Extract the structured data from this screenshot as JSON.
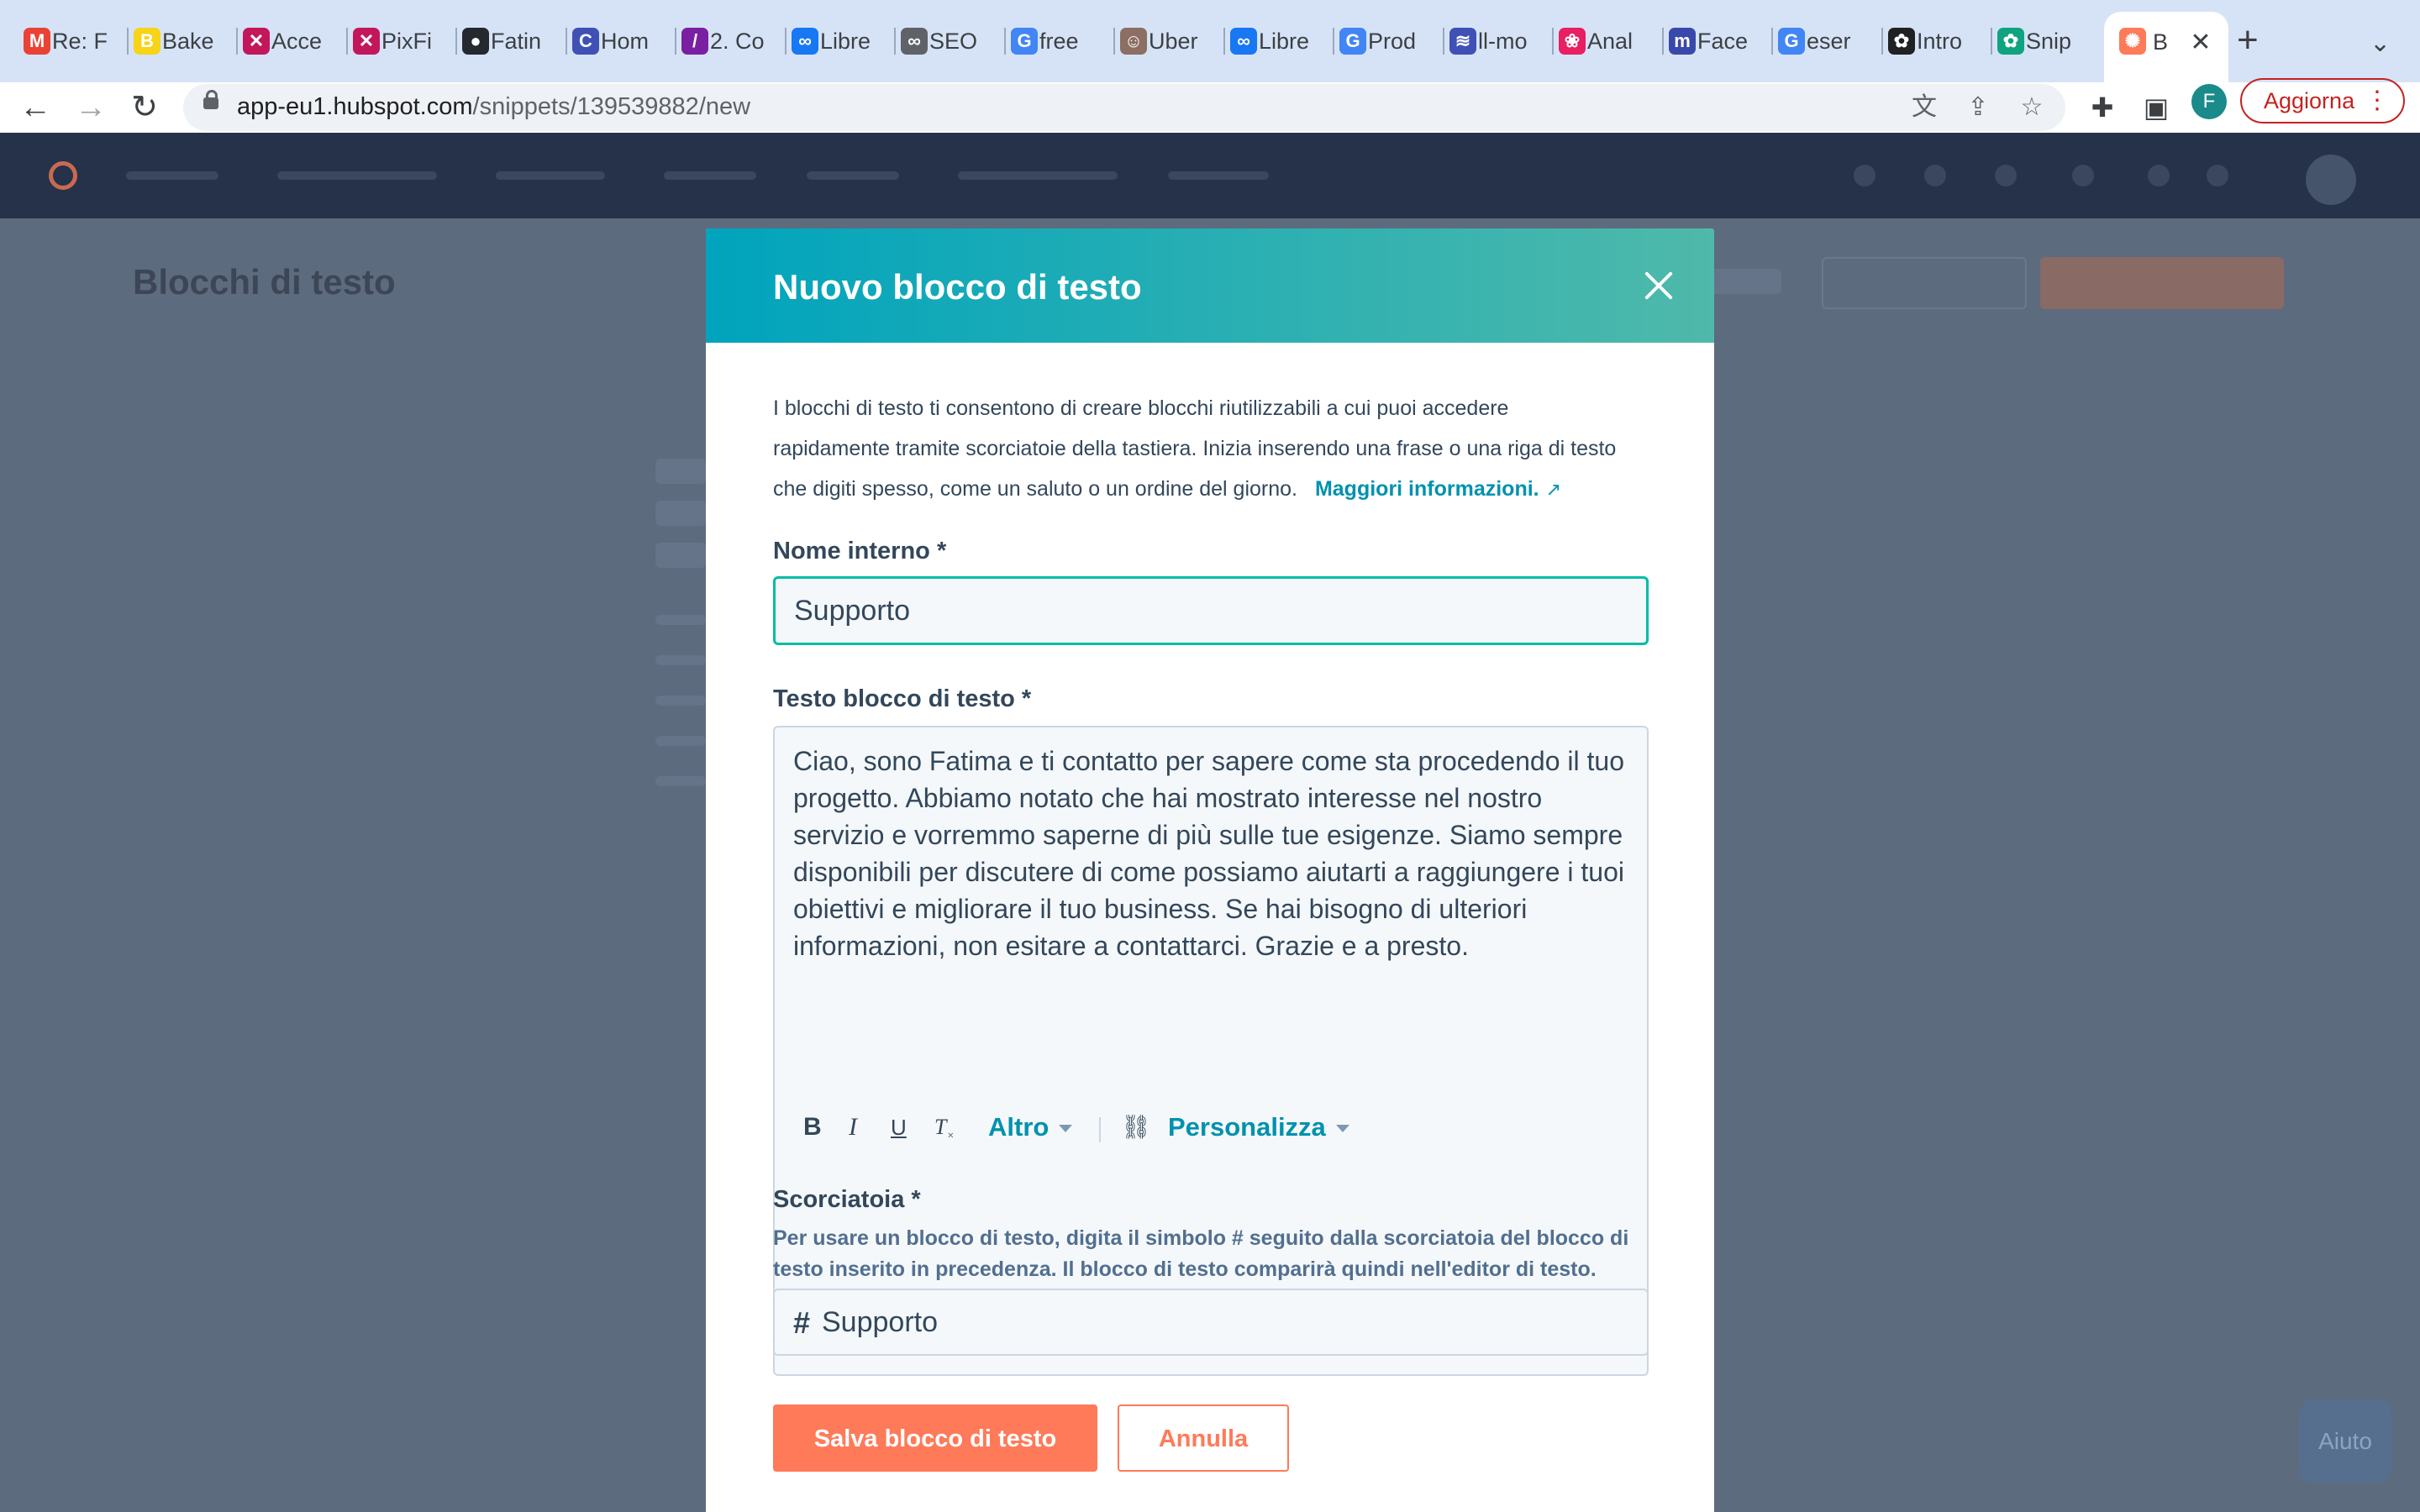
{
  "browser": {
    "tabs": [
      {
        "title": "Re: F",
        "icon": "gmail-icon",
        "color": "#ea4335",
        "glyph": "M"
      },
      {
        "title": "Bake",
        "icon": "bakery-icon",
        "color": "#f7d417",
        "glyph": "B"
      },
      {
        "title": "Acce",
        "icon": "app-icon",
        "color": "#c2185b",
        "glyph": "✕"
      },
      {
        "title": "PixFi",
        "icon": "app-icon",
        "color": "#c2185b",
        "glyph": "✕"
      },
      {
        "title": "Fatin",
        "icon": "github-icon",
        "color": "#24292f",
        "glyph": "●"
      },
      {
        "title": "Hom",
        "icon": "app-icon",
        "color": "#3f51b5",
        "glyph": "C"
      },
      {
        "title": "2. Co",
        "icon": "app-icon",
        "color": "#7b1fa2",
        "glyph": "/"
      },
      {
        "title": "Libre",
        "icon": "meta-icon",
        "color": "#1877f2",
        "glyph": "∞"
      },
      {
        "title": "SEO",
        "icon": "link-icon",
        "color": "#5f6368",
        "glyph": "∞"
      },
      {
        "title": "free",
        "icon": "google-icon",
        "color": "#4285f4",
        "glyph": "G"
      },
      {
        "title": "Uber",
        "icon": "avatar-icon",
        "color": "#8d6e63",
        "glyph": "☺"
      },
      {
        "title": "Libre",
        "icon": "meta-icon",
        "color": "#1877f2",
        "glyph": "∞"
      },
      {
        "title": "Prod",
        "icon": "google-icon",
        "color": "#4285f4",
        "glyph": "G"
      },
      {
        "title": "ll-mo",
        "icon": "app-icon",
        "color": "#3f51b5",
        "glyph": "≋"
      },
      {
        "title": "Anal",
        "icon": "app-icon",
        "color": "#e91e63",
        "glyph": "❀"
      },
      {
        "title": "Face",
        "icon": "app-icon",
        "color": "#3949ab",
        "glyph": "m"
      },
      {
        "title": "eser",
        "icon": "google-icon",
        "color": "#4285f4",
        "glyph": "G"
      },
      {
        "title": "Intro",
        "icon": "openai-icon",
        "color": "#202123",
        "glyph": "✿"
      },
      {
        "title": "Snip",
        "icon": "openai-icon",
        "color": "#10a37f",
        "glyph": "✿"
      }
    ],
    "active_tab": {
      "title": "B",
      "icon": "hubspot-icon",
      "color": "#ff7a59",
      "glyph": "✺"
    },
    "url_host": "app-eu1.hubspot.com",
    "url_path": "/snippets/139539882/new",
    "profile_initial": "F",
    "update_label": "Aggiorna"
  },
  "page": {
    "title": "Blocchi di testo",
    "help_label": "Aiuto"
  },
  "modal": {
    "title": "Nuovo blocco di testo",
    "intro": "I blocchi di testo ti consentono di creare blocchi riutilizzabili a cui puoi accedere rapidamente tramite scorciatoie della tastiera. Inizia inserendo una frase o una riga di testo che digiti spesso, come un saluto o un ordine del giorno.",
    "learn_more": "Maggiori informazioni.",
    "name_label": "Nome interno *",
    "name_value": "Supporto",
    "body_label": "Testo blocco di testo *",
    "body_text": "Ciao, sono Fatima e ti contatto per sapere come sta procedendo il tuo progetto. Abbiamo notato che hai mostrato interesse nel nostro servizio e vorremmo saperne di più sulle tue esigenze. Siamo sempre disponibili per discutere di come possiamo aiutarti a raggiungere i tuoi obiettivi e migliorare il tuo business. Se hai bisogno di ulteriori informazioni, non esitare a contattarci. Grazie e a presto.",
    "toolbar": {
      "bold": "B",
      "italic": "I",
      "underline": "U",
      "clear_format": "T",
      "more": "Altro",
      "personalize": "Personalizza"
    },
    "shortcut_label": "Scorciatoia *",
    "shortcut_help": "Per usare un blocco di testo, digita il simbolo # seguito dalla scorciatoia del blocco di testo inserito in precedenza. Il blocco di testo comparirà quindi nell'editor di testo.",
    "shortcut_prefix": "#",
    "shortcut_value": "Supporto",
    "save_label": "Salva blocco di testo",
    "cancel_label": "Annulla"
  },
  "colors": {
    "header_gradient_start": "#00a4bd",
    "header_gradient_end": "#4fb9aa",
    "primary_button": "#ff7a59",
    "link": "#0091ae",
    "overlay": "#5d6b7e"
  }
}
